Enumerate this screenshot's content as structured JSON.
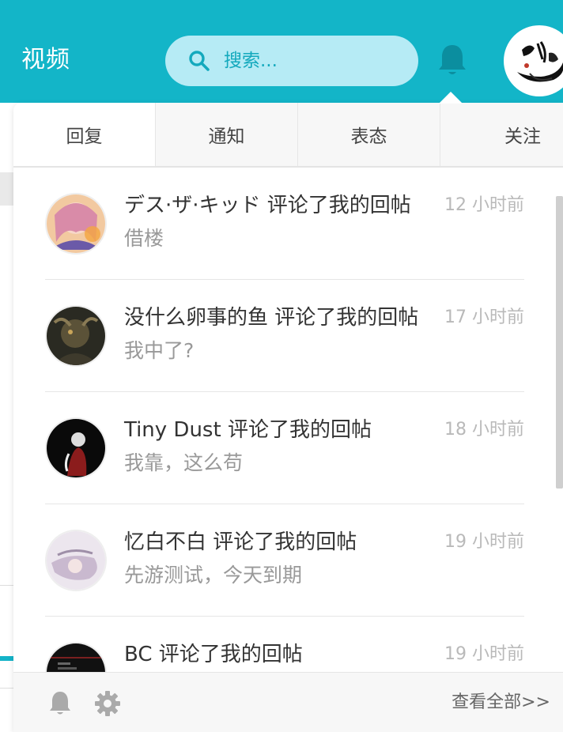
{
  "header": {
    "brand": "视频",
    "search": {
      "placeholder": "搜索..."
    }
  },
  "tabs": [
    {
      "label": "回复",
      "active": true
    },
    {
      "label": "通知",
      "active": false
    },
    {
      "label": "表态",
      "active": false
    },
    {
      "label": "关注",
      "active": false
    }
  ],
  "notifications": [
    {
      "title": "デス·ザ·キッド 评论了我的回帖",
      "content": "借楼",
      "time": "12 小时前"
    },
    {
      "title": "没什么卵事的鱼 评论了我的回帖",
      "content": "我中了?",
      "time": "17 小时前"
    },
    {
      "title": "Tiny Dust 评论了我的回帖",
      "content": "我靠，这么苟",
      "time": "18 小时前"
    },
    {
      "title": "忆白不白 评论了我的回帖",
      "content": "先游测试，今天到期",
      "time": "19 小时前"
    },
    {
      "title": "BC 评论了我的回帖",
      "content": "",
      "time": "19 小时前"
    }
  ],
  "footer": {
    "view_all": "查看全部>>"
  },
  "colors": {
    "accent": "#13b5c8",
    "search_bg": "#b6ebf5"
  }
}
